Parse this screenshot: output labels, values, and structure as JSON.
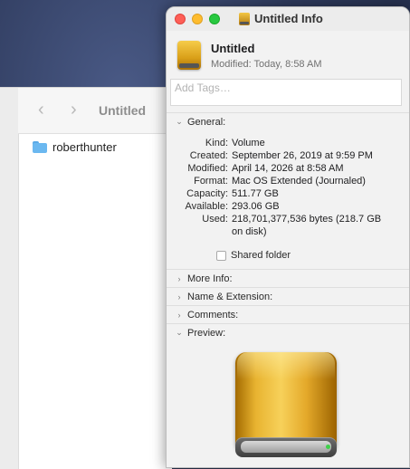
{
  "finder": {
    "title": "Untitled",
    "items": [
      {
        "name": "roberthunter"
      }
    ]
  },
  "info": {
    "window_title": "Untitled Info",
    "name": "Untitled",
    "modified": "Modified: Today, 8:58 AM",
    "tags_placeholder": "Add Tags…",
    "sections": {
      "general": "General:",
      "more_info": "More Info:",
      "name_ext": "Name & Extension:",
      "comments": "Comments:",
      "preview": "Preview:"
    },
    "general_rows": [
      {
        "key": "Kind:",
        "value": "Volume"
      },
      {
        "key": "Created:",
        "value": "September 26, 2019 at 9:59 PM"
      },
      {
        "key": "Modified:",
        "value": "April 14, 2026 at 8:58 AM"
      },
      {
        "key": "Format:",
        "value": "Mac OS Extended (Journaled)"
      },
      {
        "key": "Capacity:",
        "value": "511.77 GB"
      },
      {
        "key": "Available:",
        "value": "293.06 GB"
      },
      {
        "key": "Used:",
        "value": "218,701,377,536 bytes (218.7 GB on disk)"
      }
    ],
    "shared_folder_label": "Shared folder",
    "shared_folder_checked": false
  },
  "icons": {
    "folder": "folder-icon",
    "drive": "external-drive-icon",
    "back": "chevron-left-icon",
    "forward": "chevron-right-icon",
    "expanded": "disclosure-down-icon",
    "collapsed": "disclosure-right-icon"
  },
  "colors": {
    "close": "#fe5f57",
    "minimize": "#febc2e",
    "maximize": "#28c840",
    "drive_gold": "#e8b330",
    "folder_blue": "#6bb8f0"
  }
}
